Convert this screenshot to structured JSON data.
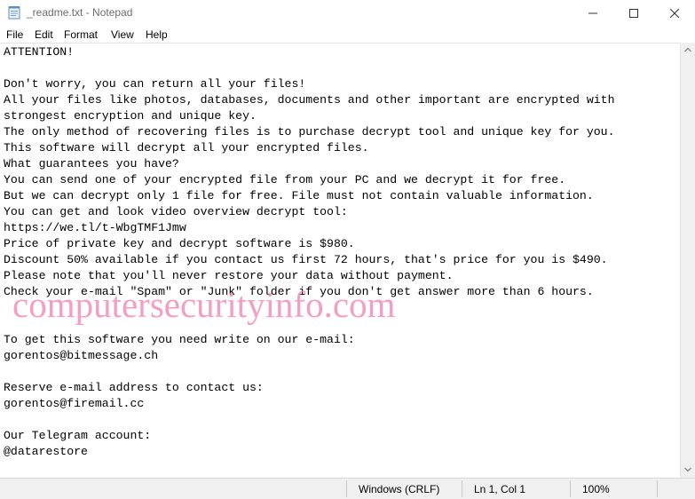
{
  "window": {
    "title": "_readme.txt - Notepad",
    "icon": "notepad-icon",
    "controls": [
      "minimize-icon",
      "maximize-icon",
      "close-icon"
    ]
  },
  "menu": [
    "File",
    "Edit",
    "Format",
    "View",
    "Help"
  ],
  "editor": {
    "lines": [
      "ATTENTION!",
      "",
      "Don't worry, you can return all your files!",
      "All your files like photos, databases, documents and other important are encrypted with",
      "strongest encryption and unique key.",
      "The only method of recovering files is to purchase decrypt tool and unique key for you.",
      "This software will decrypt all your encrypted files.",
      "What guarantees you have?",
      "You can send one of your encrypted file from your PC and we decrypt it for free.",
      "But we can decrypt only 1 file for free. File must not contain valuable information.",
      "You can get and look video overview decrypt tool:",
      "https://we.tl/t-WbgTMF1Jmw",
      "Price of private key and decrypt software is $980.",
      "Discount 50% available if you contact us first 72 hours, that's price for you is $490.",
      "Please note that you'll never restore your data without payment.",
      "Check your e-mail \"Spam\" or \"Junk\" folder if you don't get answer more than 6 hours.",
      "",
      "",
      "To get this software you need write on our e-mail:",
      "gorentos@bitmessage.ch",
      "",
      "Reserve e-mail address to contact us:",
      "gorentos@firemail.cc",
      "",
      "Our Telegram account:",
      "@datarestore"
    ]
  },
  "watermark": "computersecurityinfo.com",
  "status": {
    "encoding": "Windows (CRLF)",
    "position": "Ln 1, Col 1",
    "zoom": "100%"
  },
  "colors": {
    "watermark": "#f08bb6",
    "statusbar": "#f0f0f0"
  }
}
